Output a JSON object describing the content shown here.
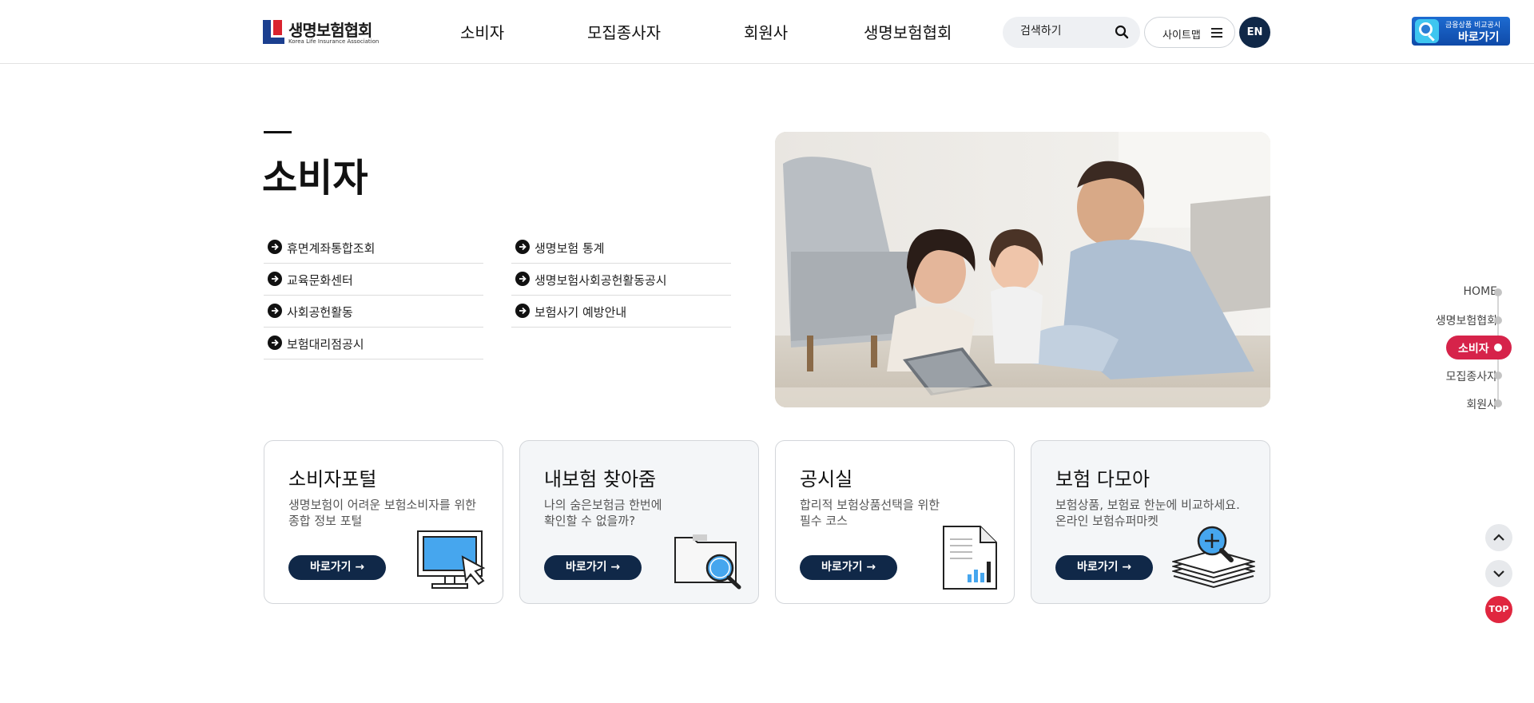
{
  "header": {
    "logo_text_ko": "생명보험협회",
    "logo_text_en": "Korea Life Insurance Association",
    "nav": [
      {
        "label": "소비자"
      },
      {
        "label": "모집종사자"
      },
      {
        "label": "회원사"
      },
      {
        "label": "생명보험협회"
      }
    ],
    "search_placeholder": "검색하기",
    "sitemap_label": "사이트맵",
    "lang_label": "EN",
    "compare_banner": {
      "small_text": "금융상품 비교공시",
      "big_text": "바로가기"
    }
  },
  "section": {
    "title": "소비자",
    "links_left": [
      {
        "label": "휴면계좌통합조회"
      },
      {
        "label": "교육문화센터"
      },
      {
        "label": "사회공헌활동"
      },
      {
        "label": "보험대리점공시"
      }
    ],
    "links_right": [
      {
        "label": "생명보험 통계"
      },
      {
        "label": "생명보험사회공헌활동공시"
      },
      {
        "label": "보험사기 예방안내"
      }
    ]
  },
  "cards": [
    {
      "title": "소비자포털",
      "desc": [
        "생명보험이 어려운 보험소비자를 위한",
        "종합 정보 포털"
      ],
      "button": "바로가기 →",
      "icon": "monitor-cursor-icon"
    },
    {
      "title": "내보험 찾아줌",
      "desc": [
        "나의 숨은보험금 한번에",
        "확인할 수 없을까?"
      ],
      "button": "바로가기 →",
      "icon": "folder-search-icon"
    },
    {
      "title": "공시실",
      "desc": [
        "합리적 보험상품선택을 위한",
        "필수 코스"
      ],
      "button": "바로가기 →",
      "icon": "document-chart-icon"
    },
    {
      "title": "보험 다모아",
      "desc": [
        "보험상품, 보험료 한눈에 비교하세요.",
        "온라인 보험슈퍼마켓"
      ],
      "button": "바로가기 →",
      "icon": "stack-search-icon"
    }
  ],
  "side_nav": {
    "items": [
      {
        "label": "HOME"
      },
      {
        "label": "생명보험협회"
      },
      {
        "label": "소비자"
      },
      {
        "label": "모집종사자"
      },
      {
        "label": "회원사"
      }
    ],
    "active_index": 2
  },
  "scroll_controls": {
    "top_label": "TOP"
  },
  "colors": {
    "brand_navy": "#102848",
    "accent_red": "#d6234a",
    "logo_blue": "#1b3f8f",
    "logo_red": "#d9232e"
  }
}
